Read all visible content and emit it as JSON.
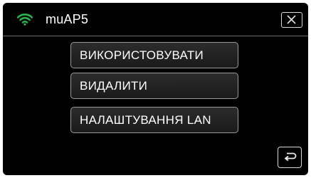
{
  "header": {
    "network_name": "muAP5",
    "wifi_icon": "wifi-signal-icon",
    "wifi_color": "#27b34a",
    "close_icon": "close-icon"
  },
  "menu": {
    "use_label": "ВИКОРИСТОВУВАТИ",
    "delete_label": "ВИДАЛИТИ",
    "lan_settings_label": "НАЛАШТУВАННЯ LAN"
  },
  "footer": {
    "back_icon": "return-arrow-icon"
  }
}
